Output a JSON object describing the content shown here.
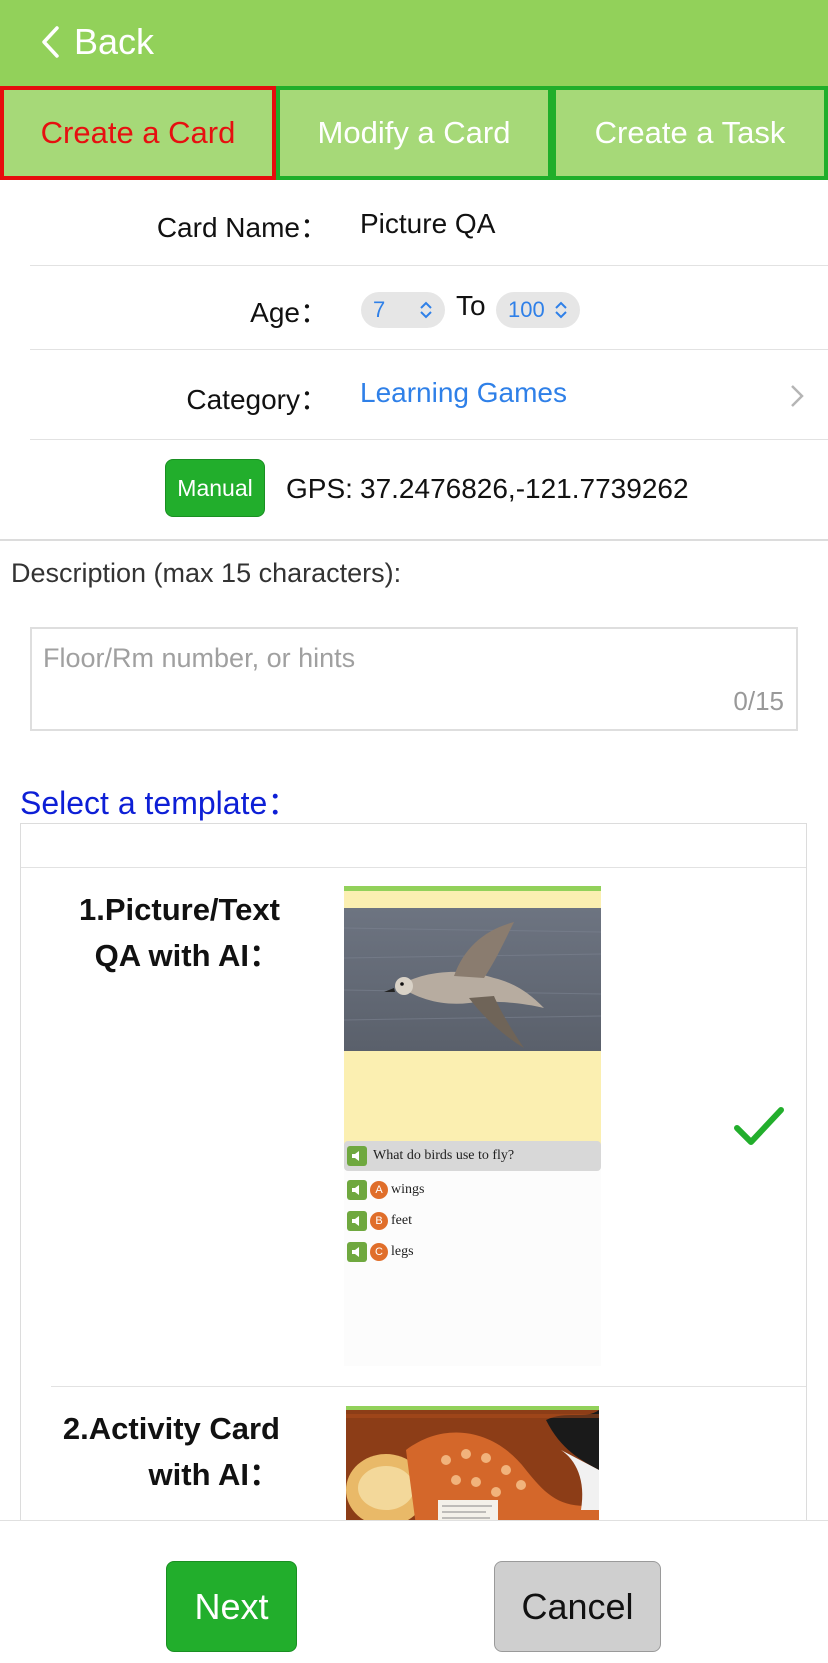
{
  "nav": {
    "back_label": "Back"
  },
  "tabs": [
    {
      "label": "Create a Card",
      "active": true
    },
    {
      "label": "Modify a Card",
      "active": false
    },
    {
      "label": "Create a Task",
      "active": false
    }
  ],
  "form": {
    "card_name_label": "Card Name：",
    "card_name_value": "Picture QA",
    "age_label": "Age：",
    "age_from": "7",
    "age_to_label": "To",
    "age_to": "100",
    "category_label": "Category：",
    "category_value": "Learning Games",
    "manual_button": "Manual",
    "gps_label": "GPS:",
    "gps_value": "37.2476826,-121.7739262"
  },
  "description": {
    "label": "Description (max 15 characters):",
    "placeholder": "Floor/Rm number, or hints",
    "counter": "0/15"
  },
  "templates": {
    "title": "Select a template：",
    "items": [
      {
        "name_line1": "1.Picture/Text",
        "name_line2": "QA with AI：",
        "selected": true,
        "question": "What do birds use to fly?",
        "options": [
          {
            "letter": "A",
            "text": "wings"
          },
          {
            "letter": "B",
            "text": "feet"
          },
          {
            "letter": "C",
            "text": "legs"
          }
        ]
      },
      {
        "name_line1": "2.Activity Card",
        "name_line2": "with AI：",
        "selected": false
      }
    ]
  },
  "footer": {
    "next_label": "Next",
    "cancel_label": "Cancel"
  },
  "colors": {
    "header_green": "#92d15a",
    "accent_red": "#e61010",
    "button_green": "#22ae2c",
    "link_blue": "#2f80e8",
    "template_title_blue": "#0d1fd6"
  }
}
